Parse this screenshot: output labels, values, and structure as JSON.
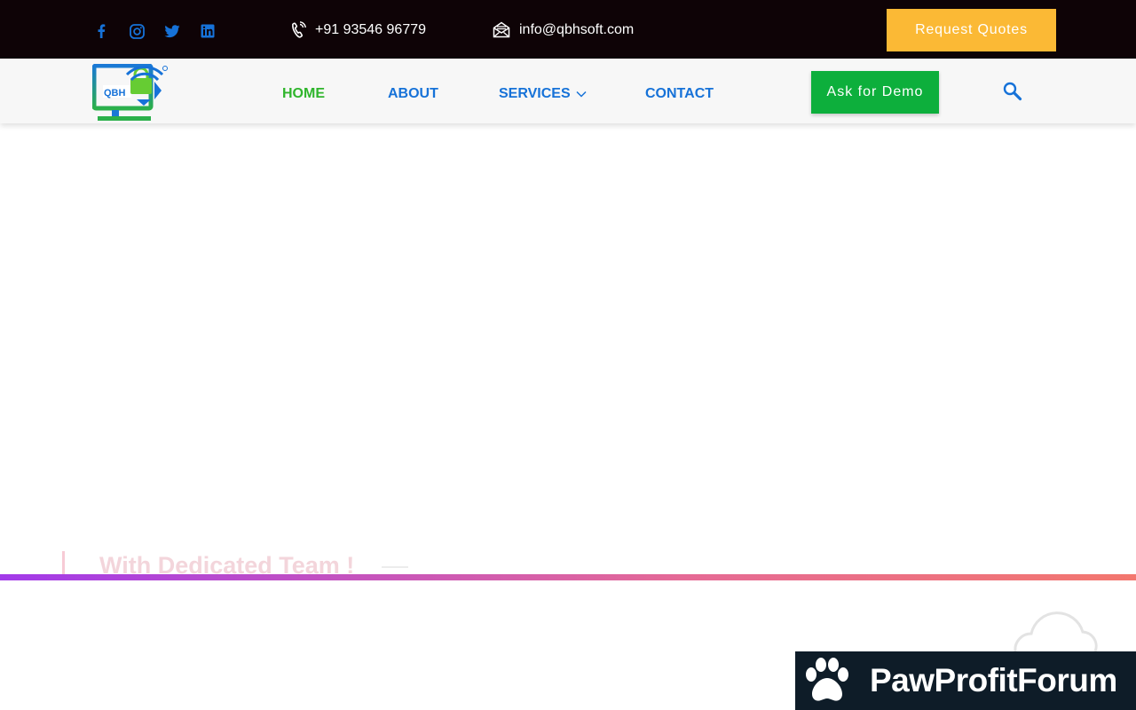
{
  "topbar": {
    "socials": [
      "facebook-icon",
      "instagram-icon",
      "twitter-icon",
      "linkedin-icon"
    ],
    "phone": "+91 93546 96779",
    "email": "info@qbhsoft.com",
    "quote_label": "Request Quotes"
  },
  "nav": {
    "logo_text": "QBH",
    "items": [
      {
        "label": "HOME",
        "active": true
      },
      {
        "label": "ABOUT"
      },
      {
        "label": "SERVICES",
        "has_dropdown": true
      },
      {
        "label": "CONTACT"
      }
    ],
    "demo_label": "Ask for Demo"
  },
  "hero": {
    "faded_heading": "With Dedicated Team !"
  },
  "watermark": {
    "text": "PawProfitForum"
  },
  "colors": {
    "topbar_bg": "#0e0306",
    "quote_btn": "#fbb935",
    "demo_btn": "#0daf3c",
    "nav_link": "#1672d8",
    "nav_active": "#2fb52c",
    "strip_start": "#a23ae9",
    "strip_end": "#f3776e"
  }
}
